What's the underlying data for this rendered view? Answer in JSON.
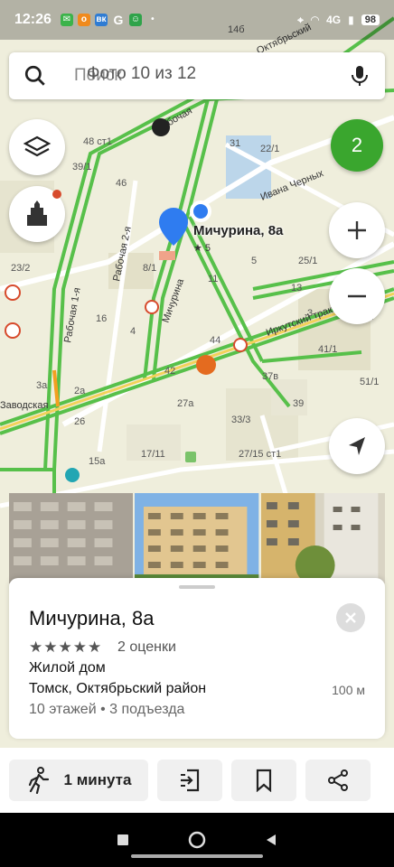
{
  "status_bar": {
    "time": "12:26",
    "notifications": [
      {
        "icon": "messages-icon",
        "color": "#3bb34a",
        "glyph": "✉"
      },
      {
        "icon": "odnoklassniki-icon",
        "color": "#f08a1c",
        "glyph": "о"
      },
      {
        "icon": "vk-icon",
        "color": "#2f7cd3",
        "glyph": "вк"
      },
      {
        "icon": "g-icon",
        "glyph": "G"
      },
      {
        "icon": "market-icon",
        "color": "#2fa34a",
        "glyph": "☺"
      },
      {
        "icon": "dot-icon",
        "glyph": "•"
      }
    ],
    "network": "4G",
    "battery": "98"
  },
  "search": {
    "placeholder": "Поиск",
    "overlay_text": "Фото 10 из 12"
  },
  "map": {
    "badge_count": "2",
    "place_label": "Мичурина, 8а",
    "place_rating": "★ 5",
    "house_numbers": [
      "48 ст1",
      "39/1",
      "46",
      "31",
      "22/1",
      "23/2",
      "8/1",
      "16",
      "11",
      "5",
      "25/1",
      "13",
      "4",
      "44",
      "42",
      "37в",
      "3а",
      "2а",
      "26",
      "27а",
      "33/3",
      "15а",
      "17/11",
      "27/15 ст1",
      "41/1",
      "51/1",
      "39",
      "7",
      "3"
    ],
    "street_labels": [
      "Рабочая",
      "Рабочая 1-я",
      "Рабочая 2-я",
      "Мичурина",
      "Ивана Черных",
      "Иркутский тракт",
      "Заводская",
      "Октябрьский"
    ],
    "top_label": "14б"
  },
  "colors": {
    "road_major": "#57c04a",
    "road_yellow": "#f2d25a",
    "map_bg": "#efeedc",
    "accent_blue": "#2f7cf0",
    "badge_green": "#3aa62e"
  },
  "card": {
    "title": "Мичурина, 8а",
    "stars": "★★★★★",
    "reviews": "2 оценки",
    "type": "Жилой дом",
    "address": "Томск, Октябрьский район",
    "distance": "100 м",
    "details": "10 этажей • 3 подъезда"
  },
  "actions": {
    "route_label": "1 минута"
  }
}
